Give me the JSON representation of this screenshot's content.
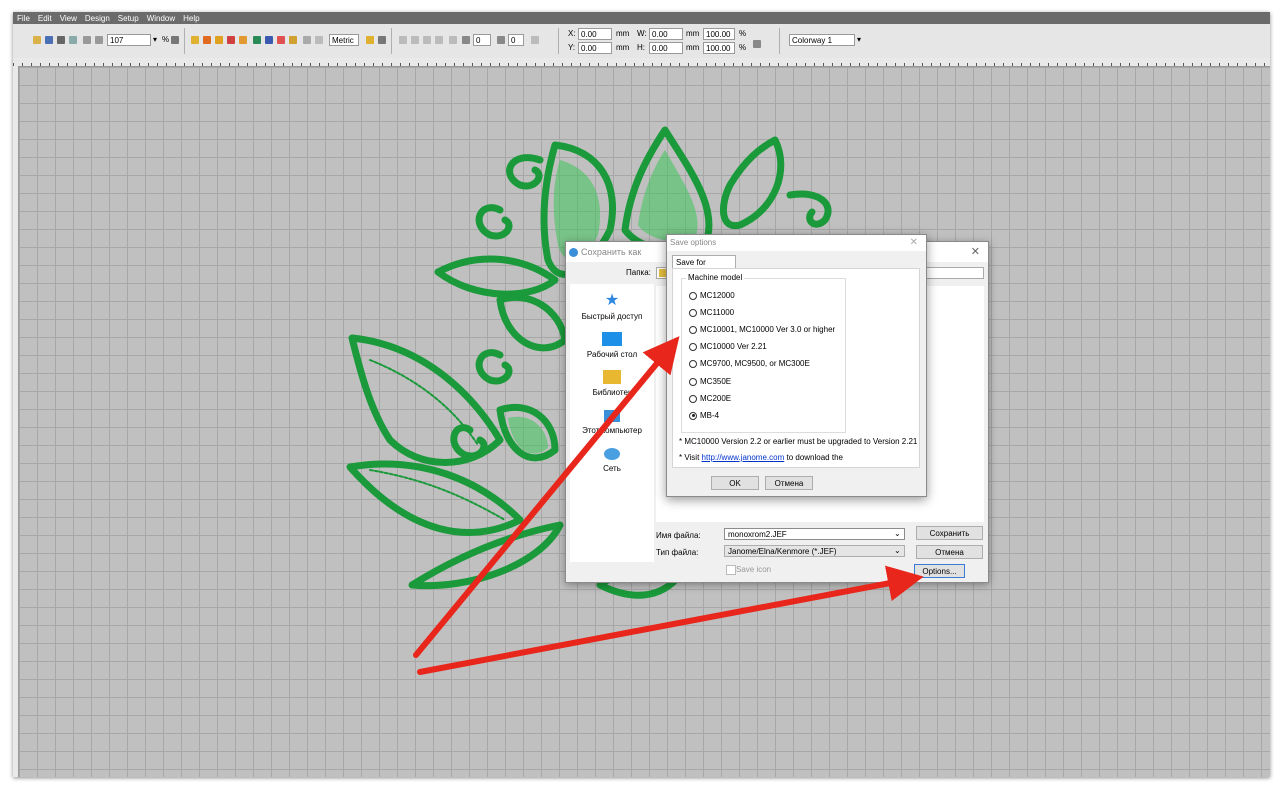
{
  "menu": [
    "File",
    "Edit",
    "View",
    "Design",
    "Setup",
    "Window",
    "Help"
  ],
  "toolbar": {
    "zoom_value": "107",
    "zoom_unit": "%",
    "units_select": "Metric",
    "rotate_value": "0",
    "slant_value": "0",
    "x_label": "X:",
    "x_value": "0.00",
    "x_unit": "mm",
    "y_label": "Y:",
    "y_value": "0.00",
    "y_unit": "mm",
    "w_label": "W:",
    "w_value": "0.00",
    "w_unit": "mm",
    "h_label": "H:",
    "h_value": "0.00",
    "h_unit": "mm",
    "w_pct": "100.00",
    "h_pct": "100.00",
    "pct_unit": "%",
    "colorway": "Colorway 1"
  },
  "file_dialog": {
    "title": "Сохранить как",
    "folder_label": "Папка:",
    "nav": [
      {
        "label": "Быстрый доступ",
        "icon": "star-icon"
      },
      {
        "label": "Рабочий стол",
        "icon": "desktop-icon"
      },
      {
        "label": "Библиотек",
        "icon": "folder-icon"
      },
      {
        "label": "Этот компьютер",
        "icon": "computer-icon"
      },
      {
        "label": "Сеть",
        "icon": "network-icon"
      }
    ],
    "filename_label": "Имя файла:",
    "filename_value": "monoxrom2.JEF",
    "filetype_label": "Тип файла:",
    "filetype_value": "Janome/Elna/Kenmore (*.JEF)",
    "save_icon_label": "Save icon",
    "save_button": "Сохранить",
    "cancel_button": "Отмена",
    "options_button": "Options..."
  },
  "options_dialog": {
    "title": "Save options",
    "tab": "Save for Machine",
    "group_label": "Machine model",
    "models": [
      {
        "label": "MC12000",
        "selected": false
      },
      {
        "label": "MC11000",
        "selected": false
      },
      {
        "label": "MC10001, MC10000 Ver 3.0 or higher",
        "selected": false
      },
      {
        "label": "MC10000 Ver 2.21",
        "selected": false
      },
      {
        "label": "MC9700, MC9500, or MC300E",
        "selected": false
      },
      {
        "label": "MC350E",
        "selected": false
      },
      {
        "label": "MC200E",
        "selected": false
      },
      {
        "label": "MB-4",
        "selected": true
      }
    ],
    "note1": "* MC10000 Version 2.2 or earlier must be upgraded to Version 2.21",
    "note2_prefix": "* Visit",
    "note2_link": "http://www.janome.com",
    "note2_suffix": "to download the",
    "ok_button": "OK",
    "cancel_button": "Отмена"
  },
  "colors": {
    "embroidery": "#1a9a3a",
    "embroidery_light": "#3cc45a",
    "arrow": "#e8261b"
  }
}
